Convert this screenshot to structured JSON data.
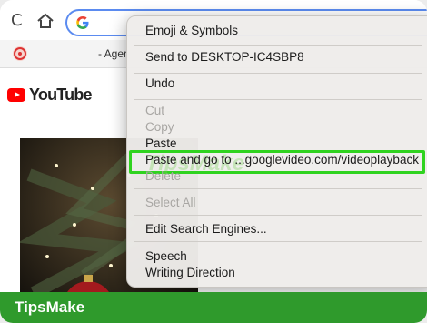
{
  "toolbar": {
    "reload_glyph": "C",
    "home_icon": "home-icon",
    "search_icon": "google-g-icon"
  },
  "bookmarks": {
    "item_label": "- Ager"
  },
  "page": {
    "logo_text": "YouTube"
  },
  "context_menu": {
    "items": [
      {
        "label": "Emoji & Symbols",
        "enabled": true
      },
      {
        "label": "Send to DESKTOP-IC4SBP8",
        "enabled": true
      },
      {
        "label": "Undo",
        "enabled": true
      },
      {
        "label": "Cut",
        "enabled": false
      },
      {
        "label": "Copy",
        "enabled": false
      },
      {
        "label": "Paste",
        "enabled": true
      },
      {
        "label": "Paste and go to ...googlevideo.com/videoplayback",
        "enabled": true,
        "highlighted": true
      },
      {
        "label": "Delete",
        "enabled": false
      },
      {
        "label": "Select All",
        "enabled": false
      },
      {
        "label": "Edit Search Engines...",
        "enabled": true
      },
      {
        "label": "Speech",
        "enabled": true
      },
      {
        "label": "Writing Direction",
        "enabled": true
      }
    ]
  },
  "watermark": {
    "text": "TipsMake"
  },
  "footer": {
    "brand": "TipsMake"
  },
  "colors": {
    "highlight_border": "#2fd31f",
    "footer_bg": "#2f9a2c",
    "youtube_red": "#ff0000",
    "omnibox_border": "#5b8bf0"
  }
}
